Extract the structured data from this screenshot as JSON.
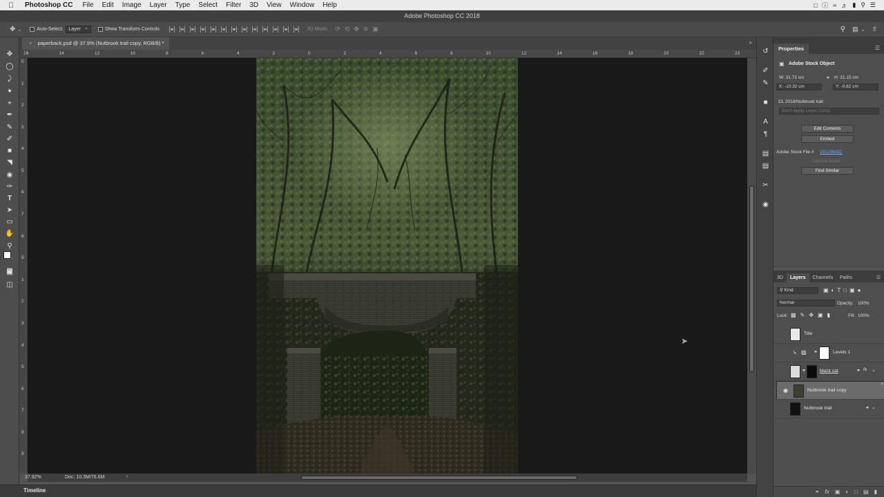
{
  "menubar": {
    "app": "Photoshop CC",
    "items": [
      "File",
      "Edit",
      "Image",
      "Layer",
      "Type",
      "Select",
      "Filter",
      "3D",
      "View",
      "Window",
      "Help"
    ]
  },
  "window": {
    "title": "Adobe Photoshop CC 2018"
  },
  "options": {
    "auto_select_label": "Auto-Select:",
    "auto_select_value": "Layer",
    "transform_label": "Show Transform Controls",
    "mode_3d": "3D Mode:"
  },
  "document": {
    "tab_title": "paperback.psd @ 37.9% (Nutbrook trail copy, RGB/8) *",
    "ruler_h": [
      "16",
      "14",
      "12",
      "10",
      "8",
      "6",
      "4",
      "2",
      "0",
      "2",
      "4",
      "6",
      "8",
      "10",
      "12",
      "14",
      "16",
      "18",
      "20",
      "22",
      "23"
    ],
    "ruler_v": [
      "0",
      "1",
      "2",
      "3",
      "4",
      "5",
      "6",
      "7",
      "8",
      "9",
      "1",
      "2",
      "3",
      "4",
      "5",
      "6",
      "7",
      "8",
      "9"
    ],
    "zoom": "37.92%",
    "doc_size": "Doc: 10.3M/76.6M"
  },
  "timeline": {
    "label": "Timeline"
  },
  "properties": {
    "title": "Properties",
    "object_type": "Adobe Stock Object",
    "w": "W:  31.72 cm",
    "h": "H:  21.15 cm",
    "x": "X:  -10.32 cm",
    "y": "Y:  -0.82 cm",
    "library": "CL 2018/Nutbrook trail",
    "layer_comp": "Don't Apply Layer Comp",
    "edit_contents": "Edit Contents",
    "embed": "Embed",
    "stock_file_label": "Adobe Stock File #",
    "stock_file_id": "151236432",
    "license_asset": "License Asset",
    "find_similar": "Find Similar"
  },
  "layers_panel": {
    "tabs": [
      "3D",
      "Layers",
      "Channels",
      "Paths"
    ],
    "active_tab": "Layers",
    "filter": "Kind",
    "blend_mode": "Normal",
    "opacity_label": "Opacity:",
    "opacity": "100%",
    "lock_label": "Lock:",
    "fill_label": "Fill:",
    "fill": "100%",
    "layers": [
      {
        "name": "Title"
      },
      {
        "name": "Levels 1"
      },
      {
        "name": "black cat"
      },
      {
        "name": "Nutbrook trail copy"
      },
      {
        "name": "Nutbrook trail"
      }
    ],
    "footer_fx": "fx"
  },
  "colors": {
    "canvas_bg": "#191919",
    "selected_layer": "#6b6b6b",
    "link_blue": "#6ab0ff"
  }
}
